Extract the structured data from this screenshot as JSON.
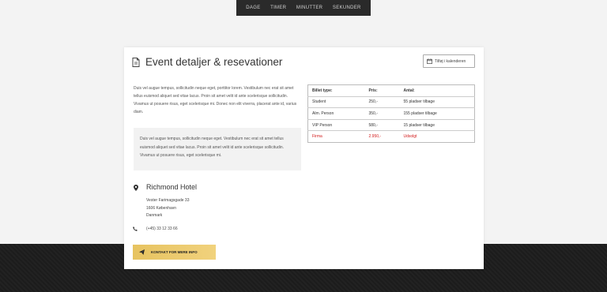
{
  "countdown": {
    "labels": [
      "DAGE",
      "TIMER",
      "MINUTTER",
      "SEKUNDER"
    ]
  },
  "event": {
    "title": "Event detaljer & resevationer",
    "calendar_button": "Tilføj i kalenderen",
    "description": "Duis vel augue tempus, sollicitudin neque eget, porttitor lorem. Vestibulum nec erat sit amet tellus euismod aliquet sed vitae lacus. Proin sit amet velit id ante scelerisque sollicitudin. Vivamus ut posuere risus, eget scelerisque mi. Donec non elit viverra, placerat ante id, varius diam.",
    "quote": "Duis vel augue tempus, sollicitudin neque eget. Vestibulum nec erat sit amet tellus euismod aliquet sed vitae lacus. Proin sit amet velit id ante scelerisque sollicitudin. Vivamus ut posuere risus, eget scelerisque mi."
  },
  "tickets": {
    "headers": [
      "Billet type:",
      "Pris:",
      "Antal:"
    ],
    "rows": [
      {
        "type": "Student",
        "price": "250,-",
        "count": "55 pladser tilbage"
      },
      {
        "type": "Alm. Person",
        "price": "350,-",
        "count": "155 pladser tilbage"
      },
      {
        "type": "VIP Person",
        "price": "580,-",
        "count": "15 pladser tilbage"
      },
      {
        "type": "Firma",
        "price": "2.950,-",
        "count": "Udsolgt"
      }
    ]
  },
  "venue": {
    "name": "Richmond Hotel",
    "address_line1": "Vester Farimagsgade 33",
    "address_line2": "1606 København",
    "address_line3": "Danmark",
    "phone": "(+45) 33 12 33 66"
  },
  "cta": {
    "label": "KONTAKT FOR MERE INFO"
  },
  "colors": {
    "accent_gold": "#e7c360",
    "sold_out_red": "#d21a1a",
    "dark_band": "#1d1d1d"
  }
}
